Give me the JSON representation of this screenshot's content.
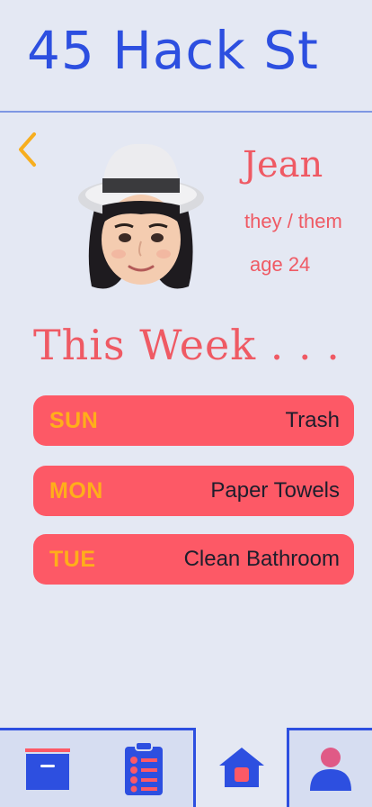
{
  "header": {
    "address": "45 Hack St"
  },
  "profile": {
    "name": "Jean",
    "pronouns": "they / them",
    "age": "age 24"
  },
  "week": {
    "title": "This Week . . .",
    "chores": [
      {
        "day": "SUN",
        "task": "Trash"
      },
      {
        "day": "MON",
        "task": "Paper Towels"
      },
      {
        "day": "TUE",
        "task": "Clean Bathroom"
      }
    ]
  },
  "nav": {
    "icons": [
      "inbox-icon",
      "checklist-icon",
      "home-icon",
      "profile-icon"
    ]
  },
  "colors": {
    "accent_blue": "#2d4fe0",
    "accent_red": "#fd5966",
    "accent_orange": "#ffae1a",
    "background": "#e4e8f3"
  }
}
